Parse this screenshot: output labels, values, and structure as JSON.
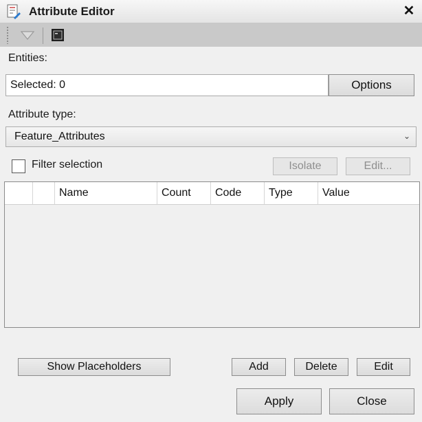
{
  "window": {
    "title": "Attribute Editor",
    "close_glyph": "✕"
  },
  "toolbar": {
    "icons": [
      "dropdown-triangle-icon",
      "console-icon"
    ]
  },
  "entities": {
    "label": "Entities:",
    "selected_value": "Selected: 0",
    "options_label": "Options"
  },
  "attribute_type": {
    "label": "Attribute type:",
    "value": "Feature_Attributes",
    "chevron": "⌄"
  },
  "filter": {
    "label": "Filter selection",
    "checked": false,
    "isolate_label": "Isolate",
    "edit_label": "Edit..."
  },
  "grid": {
    "columns": [
      "",
      "",
      "Name",
      "Count",
      "Code",
      "Type",
      "Value"
    ],
    "rows": []
  },
  "actions": {
    "show_placeholders_label": "Show Placeholders",
    "add_label": "Add",
    "delete_label": "Delete",
    "edit_label": "Edit"
  },
  "dialog": {
    "apply_label": "Apply",
    "close_label": "Close"
  },
  "colors": {
    "background": "#f0f0f0",
    "toolbar": "#c9c9c9",
    "icon_accent": "#2b7bd0"
  }
}
